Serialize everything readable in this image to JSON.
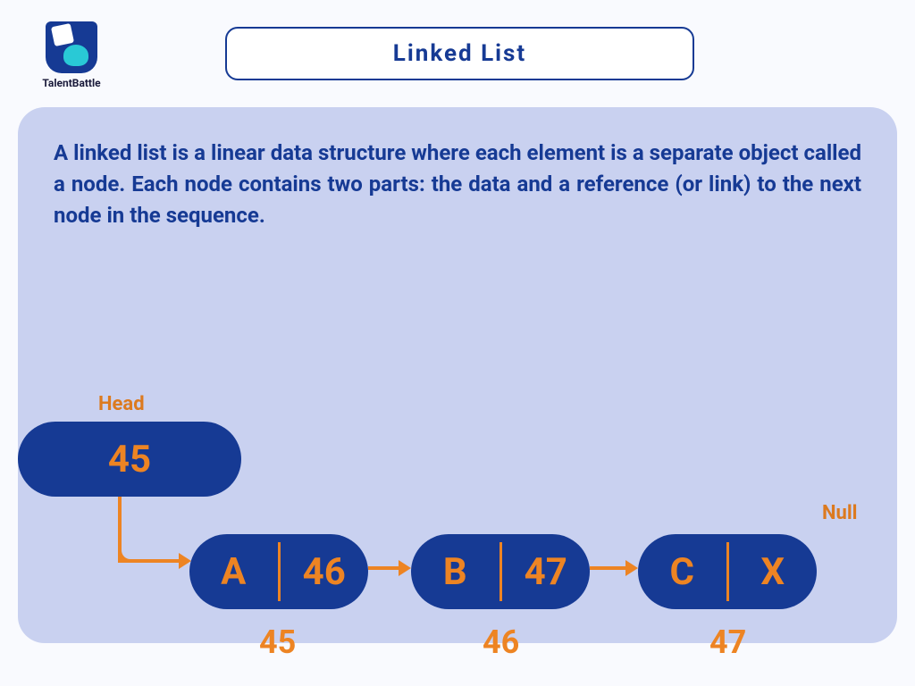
{
  "brand": {
    "name": "TalentBattle"
  },
  "title": "Linked List",
  "description": "A linked list is a linear data structure where each element is a separate object called a node. Each node contains two parts: the data and a reference (or link) to the next node in the sequence.",
  "diagram": {
    "head_label": "Head",
    "null_label": "Null",
    "head_value": "45",
    "nodes": [
      {
        "data": "A",
        "pointer": "46",
        "address": "45"
      },
      {
        "data": "B",
        "pointer": "47",
        "address": "46"
      },
      {
        "data": "C",
        "pointer": "X",
        "address": "47"
      }
    ]
  }
}
